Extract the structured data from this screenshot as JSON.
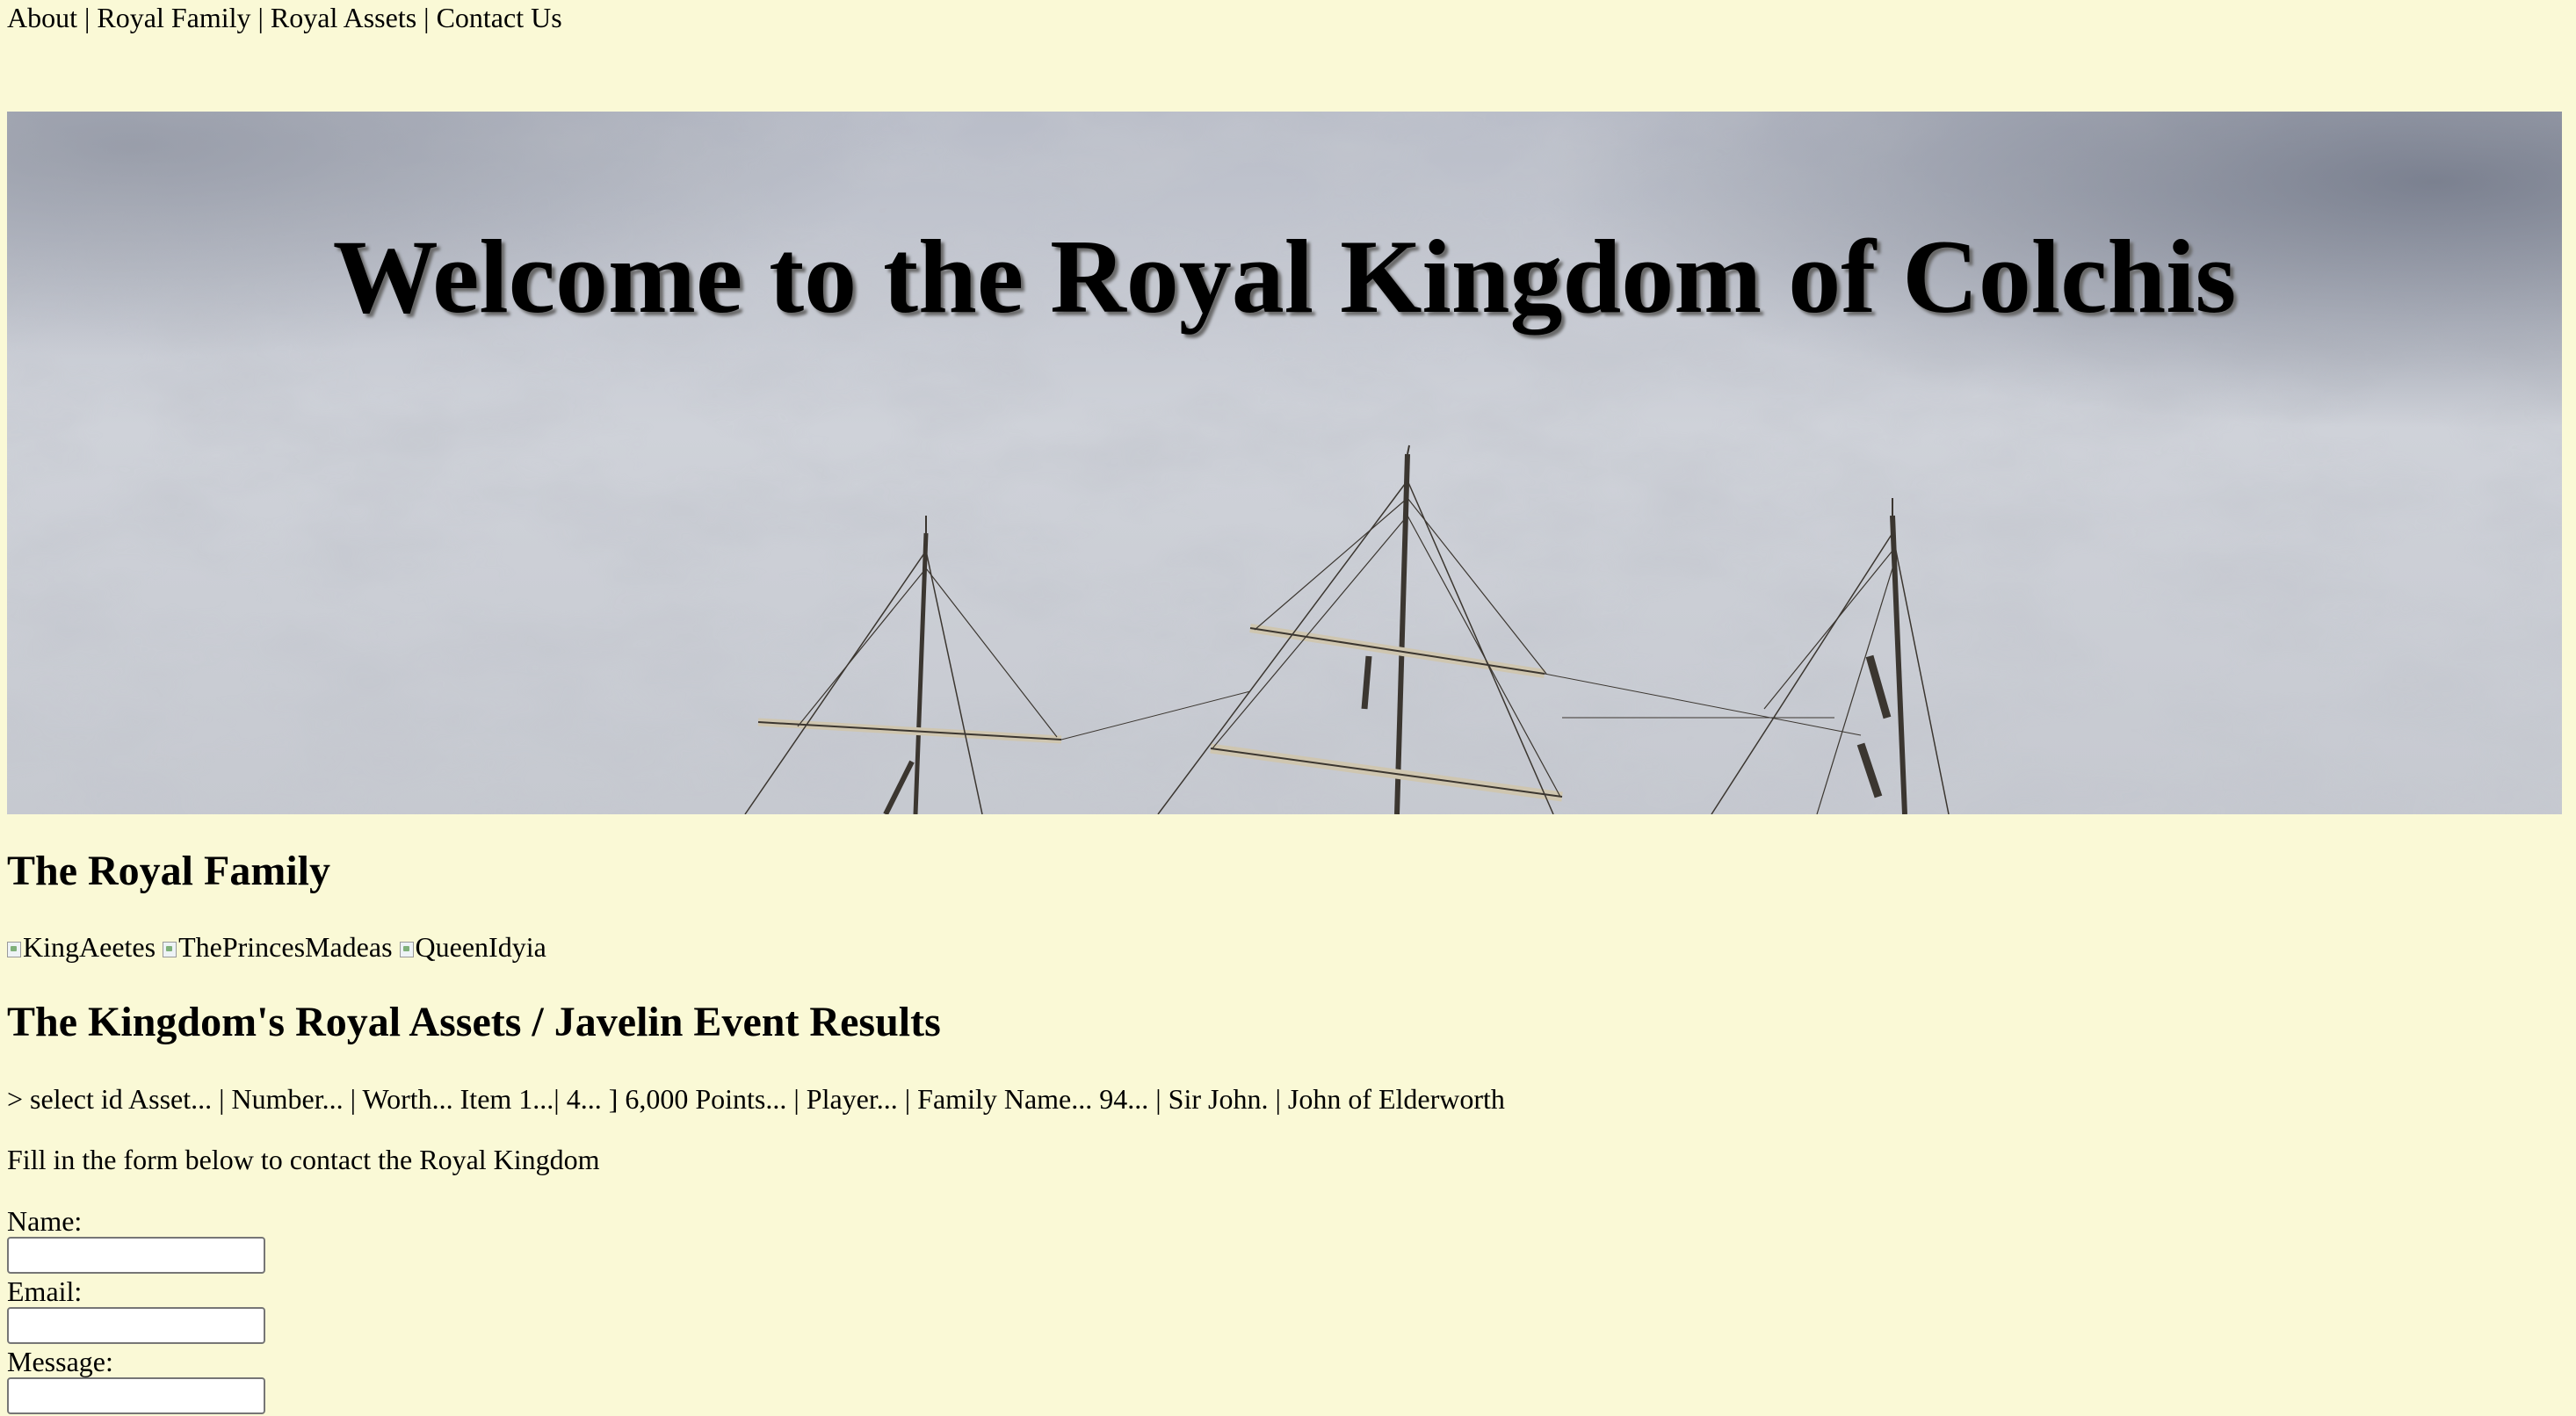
{
  "nav": {
    "items": [
      {
        "label": "About"
      },
      {
        "label": "Royal Family"
      },
      {
        "label": "Royal Assets"
      },
      {
        "label": "Contact Us"
      }
    ],
    "separator": "|"
  },
  "hero": {
    "title": "Welcome to the Royal Kingdom of Colchis",
    "background_color": "#c3c7cf"
  },
  "royal_family": {
    "heading": "The Royal Family",
    "images": [
      {
        "alt": "KingAeetes",
        "icon": "broken-image-icon"
      },
      {
        "alt": "ThePrincesMadeas",
        "icon": "broken-image-icon"
      },
      {
        "alt": "QueenIdyia",
        "icon": "broken-image-icon"
      }
    ]
  },
  "assets": {
    "heading": "The Kingdom's Royal Assets / Javelin Event Results",
    "line": "> select id Asset... | Number... | Worth... Item 1...| 4... ] 6,000 Points... | Player... | Family Name... 94... | Sir John. | John of Elderworth"
  },
  "contact": {
    "intro": "Fill in the form below to contact the Royal Kingdom",
    "name_label": "Name:",
    "name_value": "",
    "email_label": "Email:",
    "email_value": "",
    "message_label": "Message:",
    "message_value": ""
  },
  "colors": {
    "page_background": "#faf9d6",
    "text": "#000000"
  }
}
